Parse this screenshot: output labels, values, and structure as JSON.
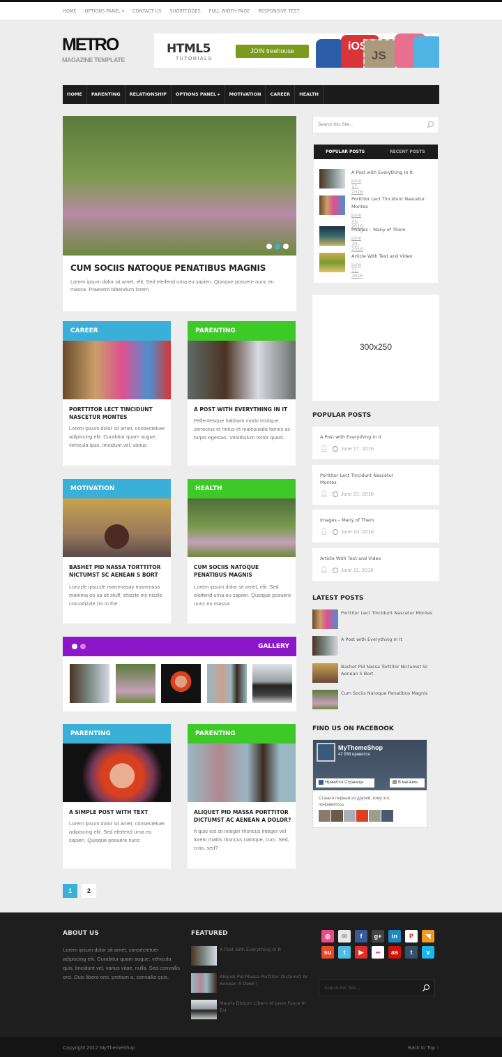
{
  "top_nav": [
    "HOME",
    "OPTIONS PANEL ▾",
    "CONTACT US",
    "SHORTCODES",
    "FULL WIDTH PAGE",
    "RESPONSIVE TEST"
  ],
  "logo": {
    "title": "METRO",
    "subtitle": "MAGAZINE TEMPLATE"
  },
  "banner": {
    "headline": "HTML5",
    "sub": "TUTORIALS",
    "cta": "JOIN treehouse",
    "badges": [
      "iOS",
      "JS"
    ]
  },
  "main_nav": [
    "HOME",
    "PARENTING",
    "RELATIONSHIP",
    "OPTIONS PANEL ▸",
    "MOTIVATION",
    "CAREER",
    "HEALTH"
  ],
  "hero": {
    "title": "CUM SOCIIS NATOQUE PENATIBUS MAGNIS",
    "excerpt": "Lorem ipsum dolor sit amet, elit. Sed eleifend urna eu sapien. Quisque posuere nunc eu massa. Praesent bibendum lorem",
    "slider_dots": 3,
    "active_dot": 2
  },
  "posts": [
    {
      "category": "CAREER",
      "color": "#3aafd8",
      "title": "PORTTITOR LECT TINCIDUNT NASCETUR MONTES",
      "excerpt": "Lorem ipsum dolor sit amet, consectetuer adipiscing elit. Curabitur quam augue, vehicula quis, tincidunt vel, varius"
    },
    {
      "category": "PARENTING",
      "color": "#3dc928",
      "title": "A POST WITH EVERYTHING IN IT",
      "excerpt": "Pellentesque habitant morbi tristique senectus et netus et malesuada fames ac turpis egestas. Vestibulum tortor quam."
    },
    {
      "category": "MOTIVATION",
      "color": "#3aafd8",
      "title": "BASHET PID NASSA TORTTITOR NICTUMST SC AENEAN S BORT",
      "excerpt": "Lorizzle ipsizzle mammasay mammasa mamma oo sa sit stuff, shizzle my nizzle crocodizzle i'm in the"
    },
    {
      "category": "HEALTH",
      "color": "#3dc928",
      "title": "CUM SOCIIS NATOQUE PENATIBUS MAGNIS",
      "excerpt": "Lorem ipsum dolor sit amet, elit. Sed eleifend urna eu sapien. Quisque posuere nunc eu massa."
    },
    {
      "category": "PARENTING",
      "color": "#3aafd8",
      "title": "A SIMPLE POST WITH TEXT",
      "excerpt": "Lorem ipsum dolor sit amet, consectetuer adipiscing elit. Sed eleifend urna eu sapien. Quisque posuere nunc"
    },
    {
      "category": "PARENTING",
      "color": "#3dc928",
      "title": "ALIQUET PID MASSA PORTTITOR DICTUMST AC AENEAN A DOLOR?",
      "excerpt": "It quis est sit integer rhoncus integer vel lorem mattis rhoncus natoque, cum. Sed, cras, sed?"
    }
  ],
  "gallery": {
    "title": "GALLERY",
    "color": "#8b17c9",
    "thumb_count": 5
  },
  "pagination": {
    "pages": [
      "1",
      "2"
    ],
    "current": "1"
  },
  "sidebar": {
    "search_placeholder": "Search this Site...",
    "tabs": [
      "POPULAR POSTS",
      "RECENT POSTS"
    ],
    "tab_posts": [
      {
        "title": "A Post with Everything In It",
        "date": "June 17, 2016"
      },
      {
        "title": "Porttitor Lect Tincidunt Nascetur Montes",
        "date": "June 21, 2016"
      },
      {
        "title": "Images – Many of Them",
        "date": "June 10, 2016"
      },
      {
        "title": "Article With Text and Video",
        "date": "June 11, 2016"
      }
    ],
    "ad_label": "300x250",
    "popular_title": "POPULAR POSTS",
    "popular": [
      {
        "title": "A Post with Everything In It",
        "date": "June 17, 2016"
      },
      {
        "title": "Porttitor Lect Tincidunt Nascetur Montes",
        "date": "June 21, 2016"
      },
      {
        "title": "Images – Many of Them",
        "date": "June 10, 2016"
      },
      {
        "title": "Article With Text and Video",
        "date": "June 11, 2016"
      }
    ],
    "latest_title": "LATEST POSTS",
    "latest": [
      "Porttitor Lect Tincidunt Nascetur Montes",
      "A Post with Everything In It",
      "Bashet Pid Nassa Torttitor Nictumst Sc Aenean S Bort",
      "Cum Sociis Natoque Penatibus Magnis"
    ],
    "facebook_title": "FIND US ON FACEBOOK",
    "facebook": {
      "page": "MyThemeShop",
      "likes": "42 938 нравится",
      "like_btn": "Нравится Страница",
      "shop_btn": "В магазин",
      "friends_text": "Станьте первым из друзей, кому это понравилось."
    }
  },
  "footer": {
    "about_title": "ABOUT US",
    "about_text": "Lorem ipsum dolor sit amet, consectetuer adipiscing elit. Curabitur quam augue, vehicula quis, tincidunt vel, varius vitae, nulla. Sed convallis orci. Duis libero orci, pretium a, convallis quis.",
    "featured_title": "FEATURED",
    "featured": [
      "A Post with Everything In It",
      "Aliquet Pid Massa Porttitor Dictumst Ac Aenean A Dolor?",
      "Mauris Dictum Libero Id Justo Fusce In Est"
    ],
    "social": [
      {
        "name": "dribbble",
        "glyph": "◎",
        "color": "#ea4c89"
      },
      {
        "name": "email",
        "glyph": "✉",
        "color": "#e8e8e8"
      },
      {
        "name": "facebook",
        "glyph": "f",
        "color": "#3b5998"
      },
      {
        "name": "google-plus",
        "glyph": "g+",
        "color": "#444"
      },
      {
        "name": "linkedin",
        "glyph": "in",
        "color": "#1d87c4"
      },
      {
        "name": "pinterest",
        "glyph": "P",
        "color": "#fff"
      },
      {
        "name": "rss",
        "glyph": "◥",
        "color": "#f39a1d"
      },
      {
        "name": "stumbleupon",
        "glyph": "su",
        "color": "#eb4923"
      },
      {
        "name": "twitter",
        "glyph": "t",
        "color": "#4fbce8"
      },
      {
        "name": "youtube",
        "glyph": "▶",
        "color": "#e52d27"
      },
      {
        "name": "flickr",
        "glyph": "••",
        "color": "#fff"
      },
      {
        "name": "lastfm",
        "glyph": "as",
        "color": "#d51007"
      },
      {
        "name": "tumblr",
        "glyph": "t",
        "color": "#35506b"
      },
      {
        "name": "vimeo",
        "glyph": "v",
        "color": "#1ab7ea"
      }
    ],
    "search_placeholder": "Search this Site...",
    "copyright": "Copyright 2012 MyThemeShop",
    "back_to_top": "Back to Top ↑"
  }
}
